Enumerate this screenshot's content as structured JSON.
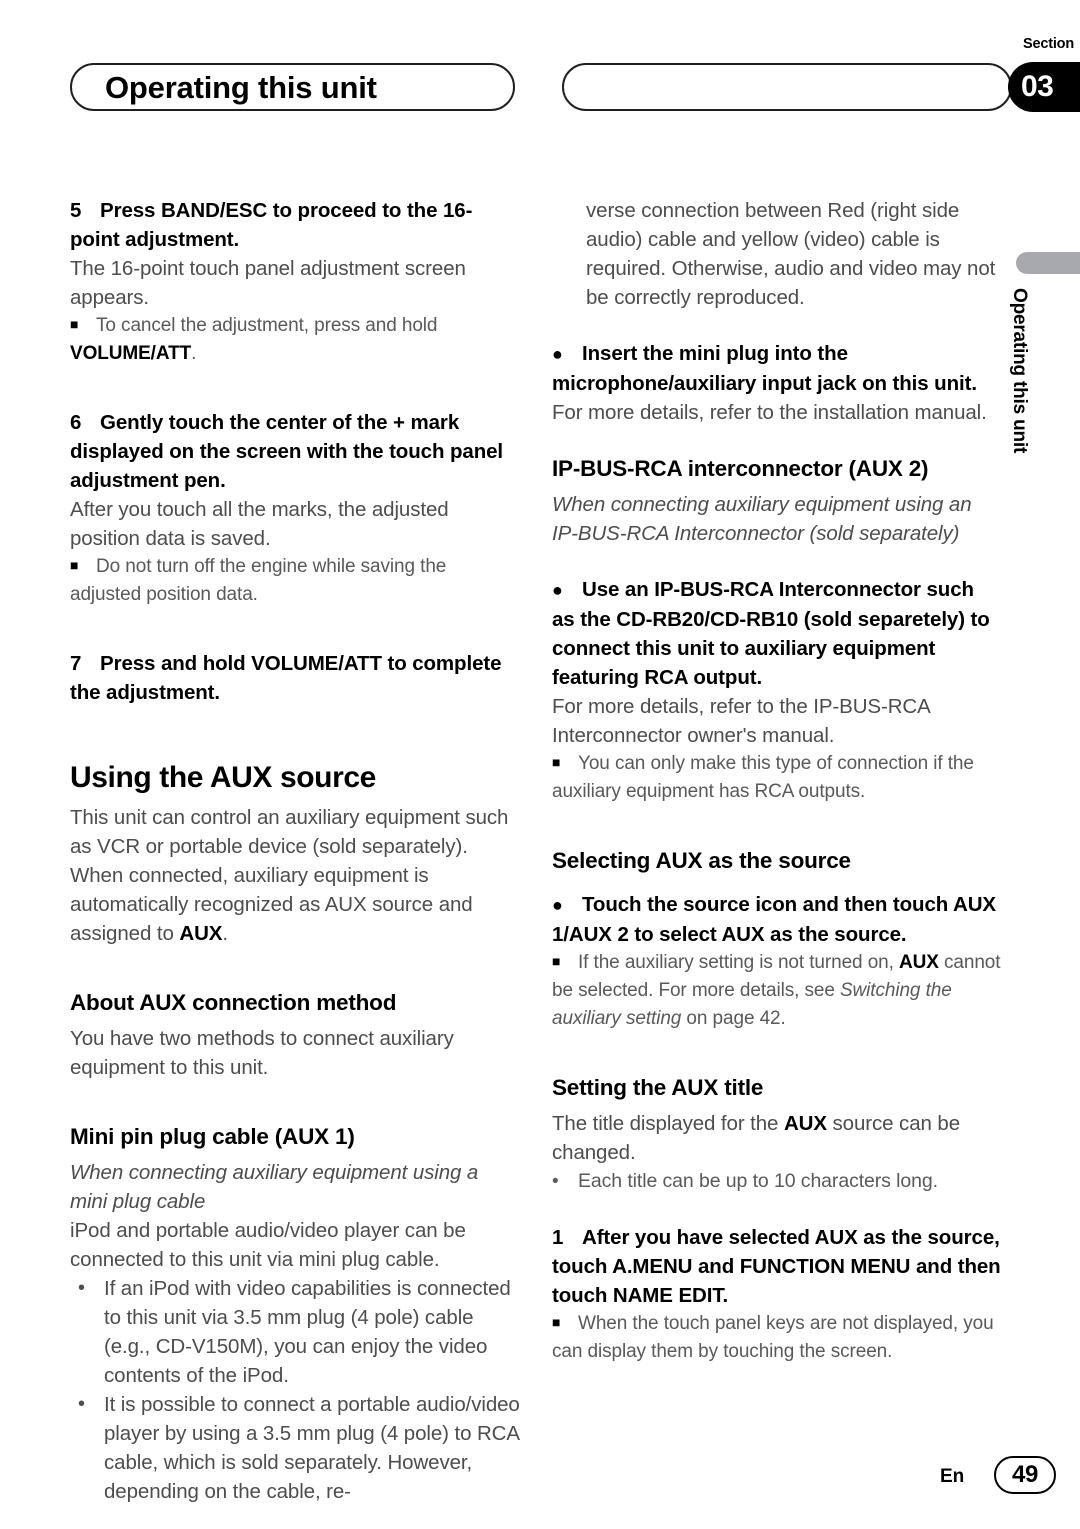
{
  "header": {
    "chapter_title": "Operating this unit",
    "section_word": "Section",
    "section_number": "03"
  },
  "side_tab": {
    "label": "Operating this unit"
  },
  "footer": {
    "language": "En",
    "page_number": "49"
  },
  "left_column": {
    "step5": {
      "number": "5",
      "text": "Press BAND/ESC to proceed to the 16-point adjustment.",
      "body": "The 16-point touch panel adjustment screen appears.",
      "note_prefix": "To cancel the adjustment, press and hold ",
      "note_bold": "VOLUME/ATT",
      "note_suffix": "."
    },
    "step6": {
      "number": "6",
      "text": "Gently touch the center of the + mark displayed on the screen with the touch panel adjustment pen.",
      "body": "After you touch all the marks, the adjusted position data is saved.",
      "note": "Do not turn off the engine while saving the adjusted position data."
    },
    "step7": {
      "number": "7",
      "text": "Press and hold VOLUME/ATT to complete the adjustment."
    },
    "aux_source": {
      "heading": "Using the AUX source",
      "body_part1": "This unit can control an auxiliary equipment such as VCR or portable device (sold separately). When connected, auxiliary equipment is automatically recognized as AUX source and assigned to ",
      "body_bold": "AUX",
      "body_part2": "."
    },
    "about_aux": {
      "heading": "About AUX connection method",
      "body": "You have two methods to connect auxiliary equipment to this unit."
    },
    "mini_pin": {
      "heading": "Mini pin plug cable (AUX 1)",
      "italic_lead": "When connecting auxiliary equipment using a mini plug cable",
      "body": "iPod and portable audio/video player can be connected to this unit via mini plug cable.",
      "bullets": [
        "If an iPod with video capabilities is connected to this unit via 3.5 mm plug (4 pole) cable (e.g., CD-V150M), you can enjoy the video contents of the iPod.",
        "It is possible to connect a portable audio/video player by using a 3.5 mm plug (4 pole) to RCA cable, which is sold separately. However, depending on the cable, re-"
      ]
    }
  },
  "right_column": {
    "continuation": "verse connection between Red (right side audio) cable and yellow (video) cable is required. Otherwise, audio and video may not be correctly reproduced.",
    "insert_plug": {
      "heading": "Insert the mini plug into the microphone/auxiliary input jack on this unit.",
      "body": "For more details, refer to the installation manual."
    },
    "ipbus": {
      "heading": "IP-BUS-RCA interconnector (AUX 2)",
      "italic_lead": "When connecting auxiliary equipment using an IP-BUS-RCA Interconnector (sold separately)",
      "bullet_head": "Use an IP-BUS-RCA Interconnector such as the CD-RB20/CD-RB10 (sold separetely) to connect this unit to auxiliary equipment featuring RCA output.",
      "body": "For more details, refer to the IP-BUS-RCA Interconnector owner's manual.",
      "note": "You can only make this type of connection if the auxiliary equipment has RCA outputs."
    },
    "selecting_aux": {
      "heading": "Selecting AUX as the source",
      "bullet_head": "Touch the source icon and then touch AUX 1/AUX 2 to select AUX as the source.",
      "note_part1": "If the auxiliary setting is not turned on, ",
      "note_bold1": "AUX",
      "note_part2": " cannot be selected. For more details, see ",
      "note_italic": "Switching the auxiliary setting",
      "note_part3": " on page 42."
    },
    "setting_title": {
      "heading": "Setting the AUX title",
      "body_part1": "The title displayed for the ",
      "body_bold": "AUX",
      "body_part2": " source can be changed.",
      "dotnote": "Each title can be up to 10 characters long.",
      "step1_number": "1",
      "step1_text": "After you have selected AUX as the source, touch A.MENU and FUNCTION MENU and then touch NAME EDIT.",
      "step1_note": "When the touch panel keys are not displayed, you can display them by touching the screen."
    }
  },
  "glyphs": {
    "square_bullet": "■",
    "round_bullet": "●",
    "dot_bullet": "•"
  }
}
